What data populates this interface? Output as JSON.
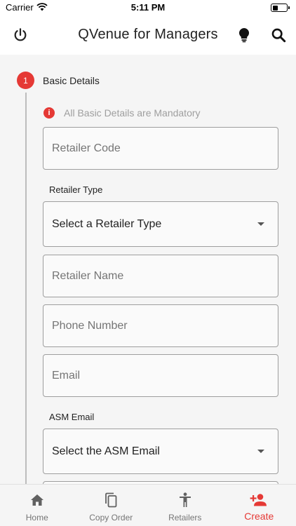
{
  "status_bar": {
    "carrier": "Carrier",
    "time": "5:11 PM",
    "battery_level": 0.4
  },
  "app_bar": {
    "title": "QVenue for Managers",
    "icons": [
      "power-icon",
      "lightbulb-icon",
      "search-icon"
    ]
  },
  "step": {
    "number": "1",
    "title": "Basic Details"
  },
  "note": {
    "text": "All Basic Details are Mandatory",
    "icon": "i"
  },
  "form": {
    "retailer_code_placeholder": "Retailer Code",
    "retailer_type_label": "Retailer Type",
    "retailer_type_value": "Select a Retailer Type",
    "retailer_name_placeholder": "Retailer Name",
    "phone_placeholder": "Phone Number",
    "email_placeholder": "Email",
    "asm_email_label": "ASM Email",
    "asm_email_value": "Select the ASM Email"
  },
  "bottom_nav": {
    "items": [
      {
        "label": "Home",
        "icon": "home-icon"
      },
      {
        "label": "Copy Order",
        "icon": "copy-icon"
      },
      {
        "label": "Retailers",
        "icon": "person-icon"
      },
      {
        "label": "Create",
        "icon": "add-person-icon",
        "active": true
      }
    ]
  },
  "colors": {
    "accent": "#e53935",
    "border": "#9e9e9e",
    "muted": "#757575"
  }
}
